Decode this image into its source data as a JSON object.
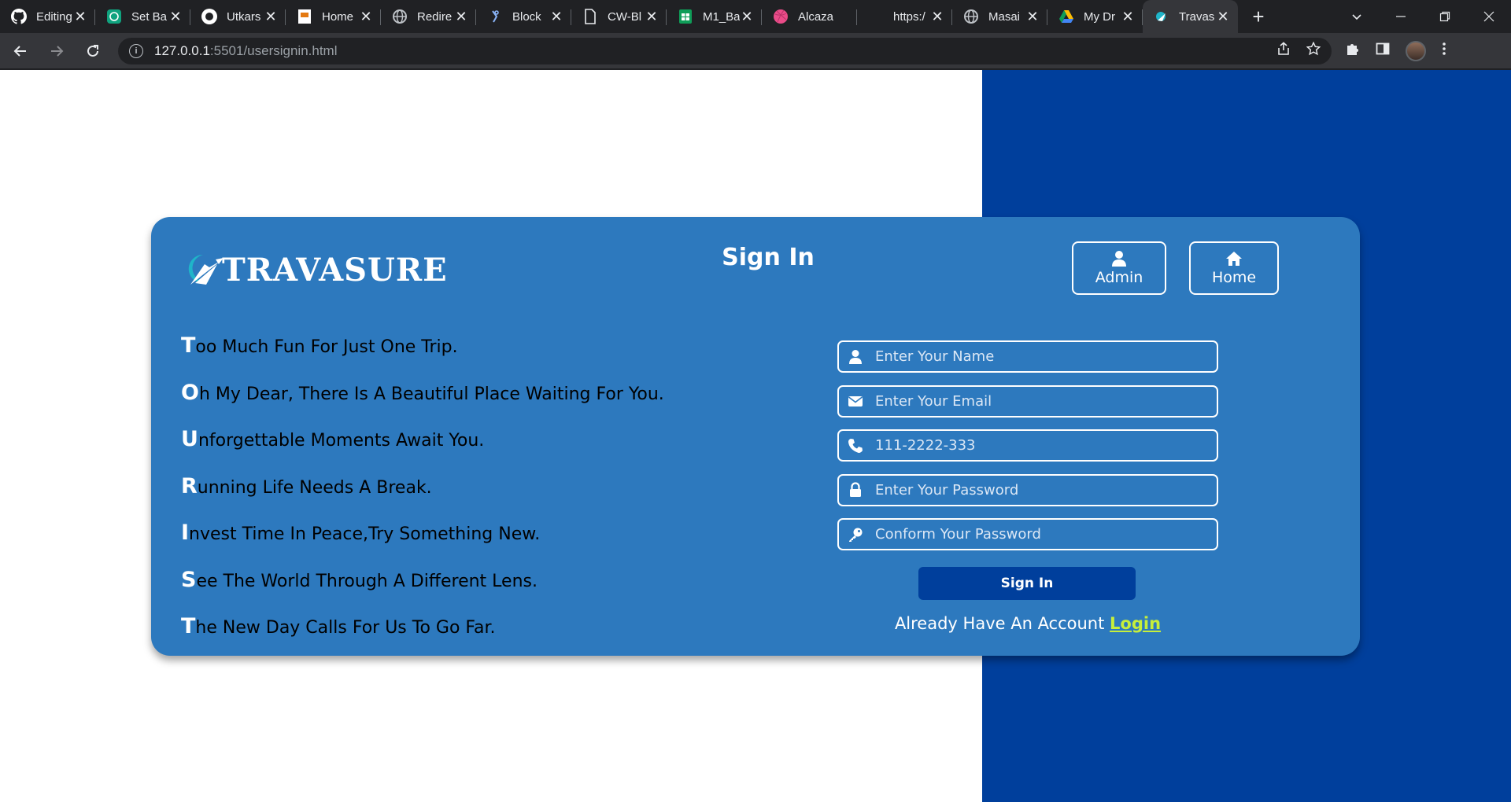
{
  "browser": {
    "tabs": [
      {
        "title": "Editing",
        "icon": "github-icon"
      },
      {
        "title": "Set Ba",
        "icon": "chatgpt-icon"
      },
      {
        "title": "Utkars",
        "icon": "github-icon"
      },
      {
        "title": "Home",
        "icon": "amazon-icon"
      },
      {
        "title": "Redire",
        "icon": "globe-icon"
      },
      {
        "title": "Block",
        "icon": "link-icon"
      },
      {
        "title": "CW-Bl",
        "icon": "doc-icon"
      },
      {
        "title": "M1_Ba",
        "icon": "sheets-icon"
      },
      {
        "title": "Alcaza",
        "icon": "dribbble-icon"
      },
      {
        "title": "https:/",
        "icon": "blank-icon"
      },
      {
        "title": "Masai",
        "icon": "globe-icon"
      },
      {
        "title": "My Dr",
        "icon": "drive-icon"
      },
      {
        "title": "Travas",
        "icon": "travasure-icon",
        "active": true
      }
    ],
    "url_host": "127.0.0.1",
    "url_path": ":5501/usersignin.html"
  },
  "page": {
    "logo_text": "TRAVASURE",
    "title": "Sign In",
    "admin_label": "Admin",
    "home_label": "Home",
    "quotes": [
      {
        "cap": "T",
        "rest": "oo Much Fun For Just One Trip."
      },
      {
        "cap": "O",
        "rest": "h My Dear, There Is A Beautiful Place Waiting For You."
      },
      {
        "cap": "U",
        "rest": "nforgettable Moments Await You."
      },
      {
        "cap": "R",
        "rest": "unning Life Needs A Break."
      },
      {
        "cap": "I",
        "rest": "nvest Time In Peace,Try Something New."
      },
      {
        "cap": "S",
        "rest": "ee The World Through A Different Lens."
      },
      {
        "cap": "T",
        "rest": "he New Day Calls For Us To Go Far."
      }
    ],
    "form": {
      "name_placeholder": "Enter Your Name",
      "email_placeholder": "Enter Your Email",
      "phone_placeholder": "111-2222-333",
      "password_placeholder": "Enter Your Password",
      "confirm_placeholder": "Conform Your Password",
      "submit_label": "Sign In",
      "account_text": "Already Have An Account",
      "login_link": "Login"
    },
    "colors": {
      "card": "#2d79be",
      "band": "#003f9c",
      "button": "#003f9c",
      "login_link": "#c6ef3b"
    }
  }
}
